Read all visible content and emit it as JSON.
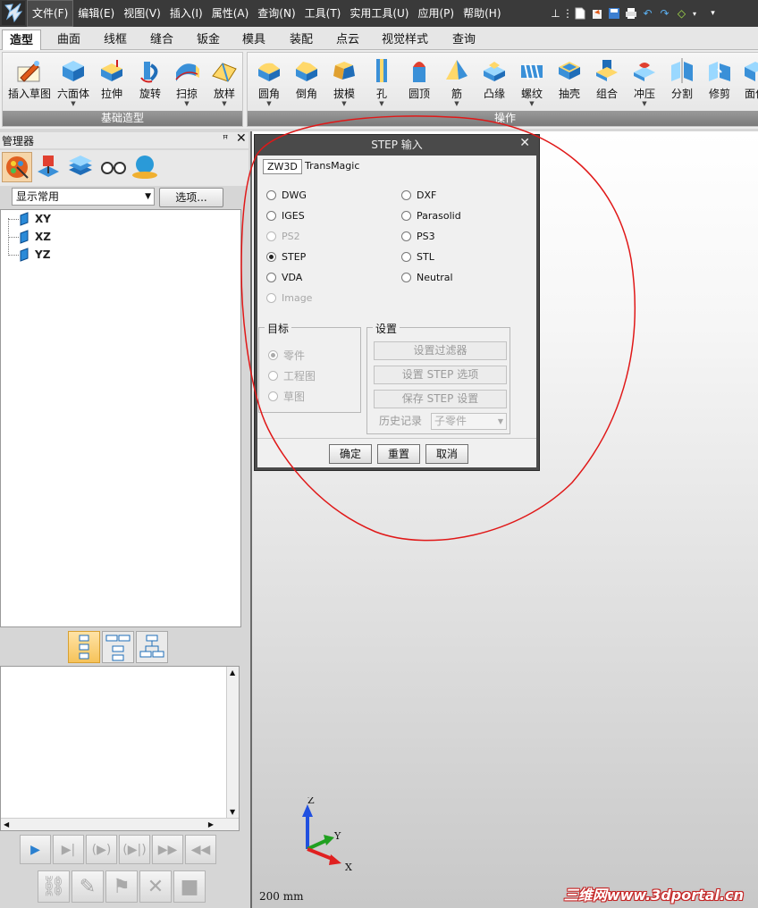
{
  "menubar": {
    "items": [
      "文件(F)",
      "编辑(E)",
      "视图(V)",
      "插入(I)",
      "属性(A)",
      "查询(N)",
      "工具(T)",
      "实用工具(U)",
      "应用(P)",
      "帮助(H)"
    ],
    "active_index": 0
  },
  "ribbon_tabs": {
    "items": [
      "造型",
      "曲面",
      "线框",
      "缝合",
      "钣金",
      "模具",
      "装配",
      "点云",
      "视觉样式",
      "查询"
    ],
    "active_index": 0
  },
  "ribbon": {
    "basic_group_label": "基础造型",
    "ops_group_label": "操作",
    "basic": [
      {
        "label": "插入草图",
        "icon": "sketch-icon",
        "dropdown": false
      },
      {
        "label": "六面体",
        "icon": "box-icon",
        "dropdown": true
      },
      {
        "label": "拉伸",
        "icon": "extrude-icon",
        "dropdown": false
      },
      {
        "label": "旋转",
        "icon": "revolve-icon",
        "dropdown": false
      },
      {
        "label": "扫掠",
        "icon": "sweep-icon",
        "dropdown": true
      },
      {
        "label": "放样",
        "icon": "loft-icon",
        "dropdown": true
      }
    ],
    "ops": [
      {
        "label": "圆角",
        "icon": "fillet-icon",
        "dropdown": true
      },
      {
        "label": "倒角",
        "icon": "chamfer-icon",
        "dropdown": false
      },
      {
        "label": "拔模",
        "icon": "draft-icon",
        "dropdown": true
      },
      {
        "label": "孔",
        "icon": "hole-icon",
        "dropdown": true
      },
      {
        "label": "圆顶",
        "icon": "dome-icon",
        "dropdown": false
      },
      {
        "label": "筋",
        "icon": "rib-icon",
        "dropdown": true
      },
      {
        "label": "凸缘",
        "icon": "flange-icon",
        "dropdown": false
      },
      {
        "label": "螺纹",
        "icon": "thread-icon",
        "dropdown": true
      },
      {
        "label": "抽壳",
        "icon": "shell-icon",
        "dropdown": false
      },
      {
        "label": "组合",
        "icon": "combine-icon",
        "dropdown": false
      },
      {
        "label": "冲压",
        "icon": "emboss-icon",
        "dropdown": true
      },
      {
        "label": "分割",
        "icon": "split-icon",
        "dropdown": false
      },
      {
        "label": "修剪",
        "icon": "trim-icon",
        "dropdown": false
      },
      {
        "label": "面偏",
        "icon": "offset-face-icon",
        "dropdown": false
      }
    ]
  },
  "manager": {
    "title": "管理器",
    "filter_value": "显示常用",
    "options_label": "选项...",
    "tree": [
      "XY",
      "XZ",
      "YZ"
    ]
  },
  "viewport": {
    "scale_label": "200 mm",
    "axis_labels": {
      "x": "X",
      "y": "Y",
      "z": "Z"
    },
    "watermark": "三维网www.3dportal.cn"
  },
  "dialog": {
    "title": "STEP 输入",
    "tabs": [
      "ZW3D",
      "TransMagic"
    ],
    "formats": [
      {
        "label": "DWG",
        "checked": false,
        "disabled": false
      },
      {
        "label": "IGES",
        "checked": false,
        "disabled": false
      },
      {
        "label": "PS2",
        "checked": false,
        "disabled": true
      },
      {
        "label": "STEP",
        "checked": true,
        "disabled": false
      },
      {
        "label": "VDA",
        "checked": false,
        "disabled": false
      },
      {
        "label": "Image",
        "checked": false,
        "disabled": true
      },
      {
        "label": "DXF",
        "checked": false,
        "disabled": false
      },
      {
        "label": "Parasolid",
        "checked": false,
        "disabled": false
      },
      {
        "label": "PS3",
        "checked": false,
        "disabled": false
      },
      {
        "label": "STL",
        "checked": false,
        "disabled": false
      },
      {
        "label": "Neutral",
        "checked": false,
        "disabled": false
      }
    ],
    "target": {
      "title": "目标",
      "options": [
        "零件",
        "工程图",
        "草图"
      ],
      "selected_index": 0
    },
    "settings": {
      "title": "设置",
      "filter_btn": "设置过滤器",
      "options_btn": "设置 STEP 选项",
      "save_btn": "保存 STEP 设置",
      "history_label": "历史记录",
      "history_value": "子零件"
    },
    "ok": "确定",
    "reset": "重置",
    "cancel": "取消"
  },
  "colors": {
    "menubar_bg": "#3a3a3a",
    "dialog_title_bg": "#4a4a4a",
    "annotation": "#e01818",
    "ribbon_group_label_bg": "#8a8a8a"
  }
}
